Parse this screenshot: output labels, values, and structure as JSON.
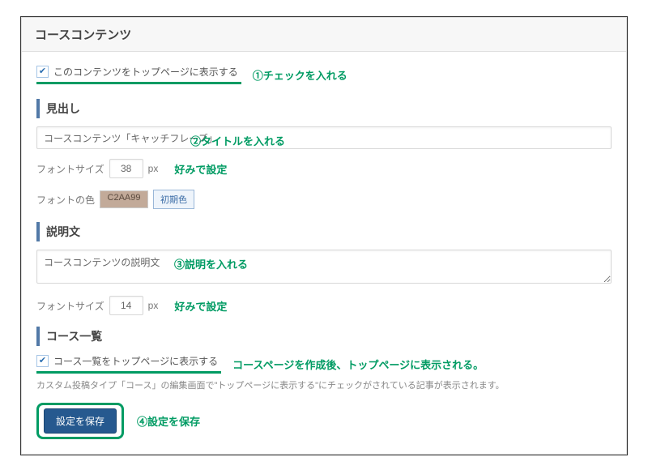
{
  "panelTitle": "コースコンテンツ",
  "showOnTop": {
    "label": "このコンテンツをトップページに表示する",
    "checked": true
  },
  "notes": {
    "check": "①チェックを入れる",
    "title": "②タイトルを入れる",
    "desc": "③説明を入れる",
    "save": "④設定を保存",
    "font1": "好みで設定",
    "font2": "好みで設定",
    "courseTop": "コースページを作成後、トップページに表示される。"
  },
  "heading": {
    "sectionTitle": "見出し",
    "inputValue": "コースコンテンツ「キャッチフレーズ」",
    "fontSizeLabel": "フォントサイズ",
    "fontSize": "38",
    "px": "px",
    "fontColorLabel": "フォントの色",
    "fontColor": "C2AA99",
    "resetBtn": "初期色"
  },
  "description": {
    "sectionTitle": "説明文",
    "inputValue": "コースコンテンツの説明文",
    "fontSizeLabel": "フォントサイズ",
    "fontSize": "14",
    "px": "px"
  },
  "courseList": {
    "sectionTitle": "コース一覧",
    "showLabel": "コース一覧をトップページに表示する",
    "help": "カスタム投稿タイプ「コース」の編集画面で\"トップページに表示する\"にチェックがされている記事が表示されます。"
  },
  "saveBtn": "設定を保存"
}
